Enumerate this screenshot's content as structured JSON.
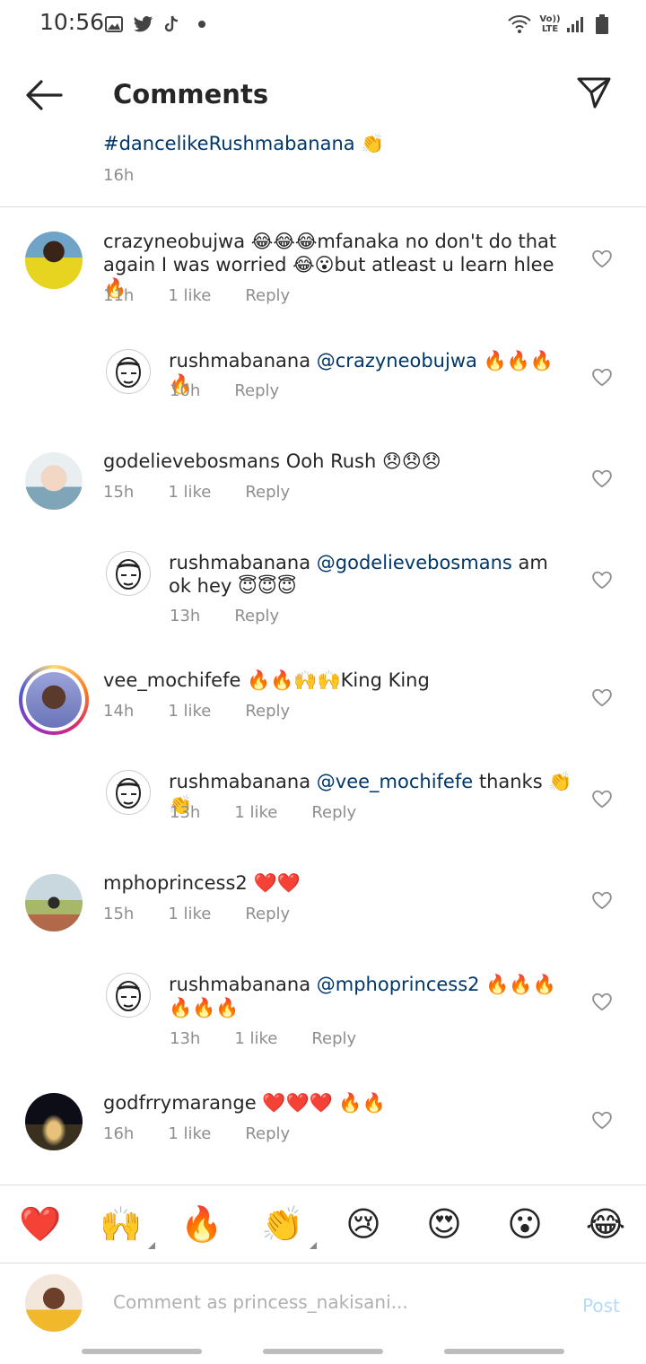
{
  "status_bar": {
    "time": "10:56",
    "notification_icons": [
      "gallery-icon",
      "twitter-icon",
      "tiktok-icon",
      "dot-icon"
    ],
    "system_icons": [
      "wifi-icon",
      "volte-icon",
      "signal-icon",
      "battery-icon"
    ],
    "volte_label": "Vo)) LTE"
  },
  "header": {
    "title": "Comments"
  },
  "post": {
    "caption": "#dancelikeRushmabanana 👏",
    "time": "16h"
  },
  "comments": [
    {
      "username": "crazyneobujwa",
      "text": " 😂😂😂mfanaka no don't do that again I was worried 😂😮but atleast u learn hlee🔥",
      "time": "11h",
      "likes": "1 like",
      "reply": "Reply",
      "replies": [
        {
          "username": "rushmabanana",
          "mention": "@crazyneobujwa",
          "text": " 🔥🔥🔥🔥",
          "time": "10h",
          "likes": "",
          "reply": "Reply"
        }
      ]
    },
    {
      "username": "godelievebosmans",
      "text": " Ooh Rush 😞😞😞",
      "time": "15h",
      "likes": "1 like",
      "reply": "Reply",
      "replies": [
        {
          "username": "rushmabanana",
          "mention": "@godelievebosmans",
          "text": " am ok hey 😇😇😇",
          "time": "13h",
          "likes": "",
          "reply": "Reply"
        }
      ]
    },
    {
      "username": "vee_mochifefe",
      "text": " 🔥🔥🙌🙌King King",
      "time": "14h",
      "likes": "1 like",
      "reply": "Reply",
      "replies": [
        {
          "username": "rushmabanana",
          "mention": "@vee_mochifefe",
          "text": " thanks 👏👏",
          "time": "13h",
          "likes": "1 like",
          "reply": "Reply"
        }
      ]
    },
    {
      "username": "mphoprincess2",
      "text": " ❤️❤️",
      "time": "15h",
      "likes": "1 like",
      "reply": "Reply",
      "replies": [
        {
          "username": "rushmabanana",
          "mention": "@mphoprincess2",
          "text": " 🔥🔥🔥🔥🔥🔥",
          "time": "13h",
          "likes": "1 like",
          "reply": "Reply"
        }
      ]
    },
    {
      "username": "godfrrymarange",
      "text": " ❤️❤️❤️ 🔥🔥",
      "time": "16h",
      "likes": "1 like",
      "reply": "Reply",
      "replies": []
    }
  ],
  "reactions": [
    "❤️",
    "🙌",
    "🔥",
    "👏",
    "😢",
    "😍",
    "😮",
    "😂"
  ],
  "comment_input": {
    "placeholder": "Comment as princess_nakisani...",
    "post_label": "Post"
  },
  "colors": {
    "mention": "#00376b",
    "meta": "#8e8e8e",
    "post_disabled": "#b3dbff"
  }
}
